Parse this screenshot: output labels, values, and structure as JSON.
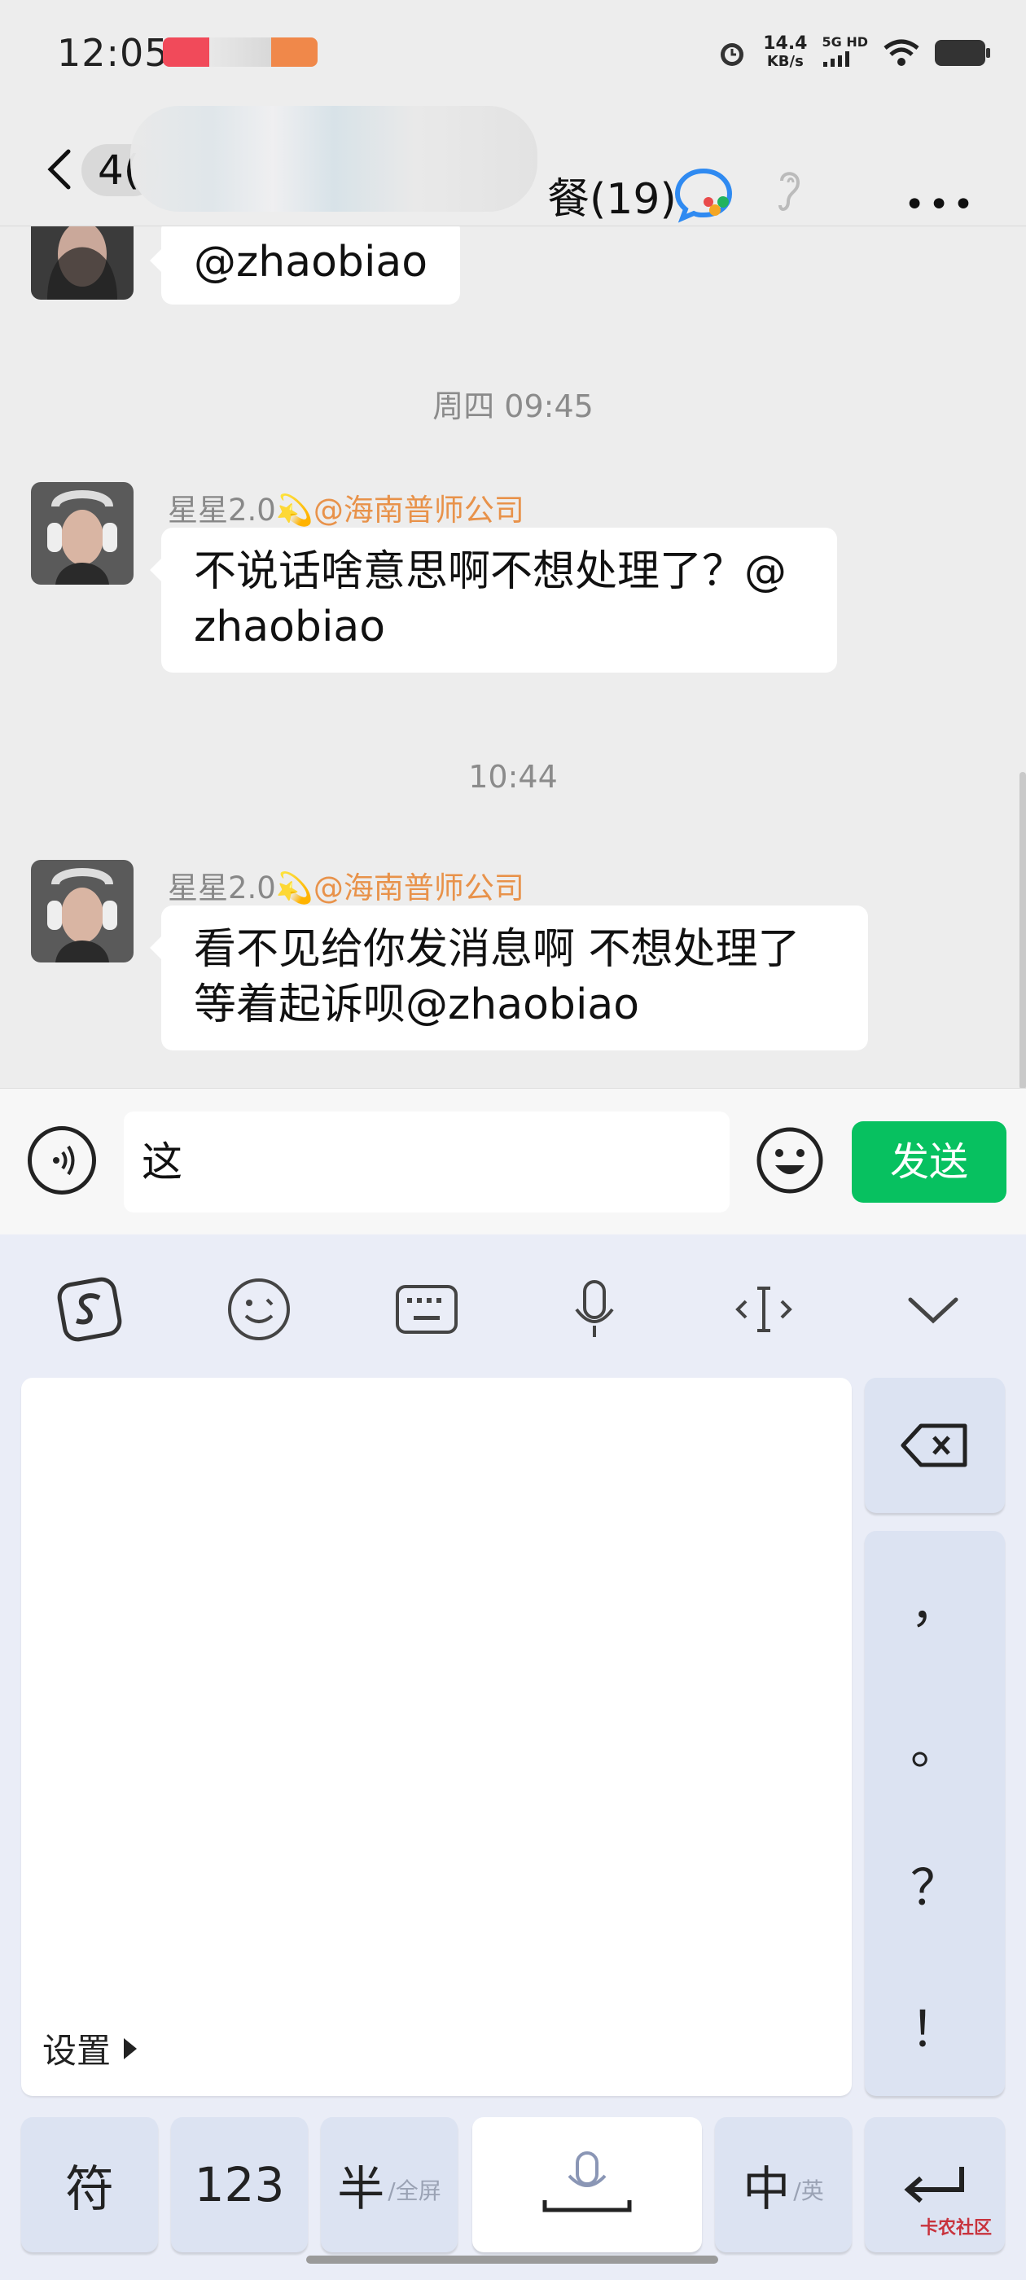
{
  "status_bar": {
    "time": "12:05",
    "net_speed_value": "14.4",
    "net_speed_unit": "KB/s",
    "network": "5G HD"
  },
  "header": {
    "title_visible_prefix": "4(",
    "title_visible_suffix": "餐(19)"
  },
  "messages": [
    {
      "type": "bubble_partial",
      "text": "@zhaobiao"
    },
    {
      "type": "time",
      "text": "周四 09:45"
    },
    {
      "type": "message",
      "sender_name": "星星2.0💫",
      "sender_org": "@海南普师公司",
      "lines": [
        "不说话啥意思啊不想处理了？@",
        "zhaobiao"
      ]
    },
    {
      "type": "time",
      "text": "10:44"
    },
    {
      "type": "message",
      "sender_name": "星星2.0💫",
      "sender_org": "@海南普师公司",
      "lines": [
        "看不见给你发消息啊  不想处理了",
        "等着起诉呗@zhaobiao"
      ]
    }
  ],
  "input": {
    "value": "这",
    "send_label": "发送"
  },
  "keyboard": {
    "settings_label": "设置",
    "side_keys": [
      "，",
      "。",
      "？",
      "！"
    ],
    "bottom": {
      "symbol": "符",
      "numeric": "123",
      "half": "半",
      "half_sub": "/全屏",
      "chinese": "中",
      "chinese_sub": "/英"
    },
    "watermark": "卡农社区"
  },
  "colors": {
    "send_button": "#07c160",
    "org_text": "#e8924a",
    "chat_bg": "#ededed",
    "keyboard_bg": "#eaedf7"
  }
}
